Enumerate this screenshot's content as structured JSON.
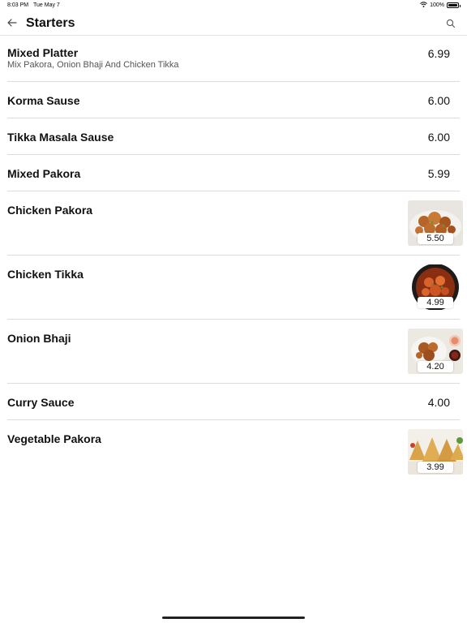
{
  "status_bar": {
    "time": "8:03 PM",
    "date": "Tue May 7",
    "battery": "100%",
    "battery_level": 1.0
  },
  "nav": {
    "title": "Starters",
    "back_icon": "arrow-left-icon",
    "search_icon": "search-icon"
  },
  "items": [
    {
      "name": "Mixed Platter",
      "description": "Mix Pakora, Onion Bhaji And Chicken Tikka",
      "price": "6.99"
    },
    {
      "name": "Korma Sause",
      "price": "6.00"
    },
    {
      "name": "Tikka Masala Sause",
      "price": "6.00"
    },
    {
      "name": "Mixed Pakora",
      "price": "5.99"
    },
    {
      "name": "Chicken Pakora",
      "price": "5.50",
      "image": "chicken-pakora-photo"
    },
    {
      "name": "Chicken Tikka",
      "price": "4.99",
      "image": "chicken-tikka-photo"
    },
    {
      "name": "Onion Bhaji",
      "price": "4.20",
      "image": "onion-bhaji-photo"
    },
    {
      "name": "Curry Sauce",
      "price": "4.00"
    },
    {
      "name": "Vegetable Pakora",
      "price": "3.99",
      "image": "vegetable-pakora-photo"
    }
  ]
}
